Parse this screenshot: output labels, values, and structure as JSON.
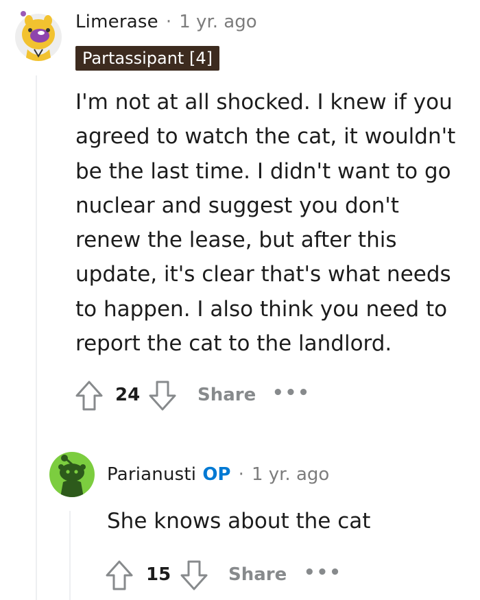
{
  "comments": [
    {
      "username": "Limerase",
      "separator": "·",
      "time": "1 yr. ago",
      "flair": "Partassipant [4]",
      "body": "I'm not at all shocked. I knew if you agreed to watch the cat, it wouldn't be the last time. I didn't want to go nuclear and suggest you don't renew the lease, but after this update, it's clear that's what needs to happen. I also think you need to report the cat to the landlord.",
      "votes": "24",
      "share_label": "Share",
      "more_label": "•••",
      "avatar_icon": "snoo-hamster-avatar-icon"
    },
    {
      "username": "Parianusti",
      "op_badge": "OP",
      "separator": "·",
      "time": "1 yr. ago",
      "body": "She knows about the cat",
      "votes": "15",
      "share_label": "Share",
      "more_label": "•••",
      "avatar_icon": "default-snoo-avatar-icon"
    }
  ],
  "colors": {
    "flair_bg": "#3d2b1f",
    "op": "#0079d3",
    "avatar2_bg": "#7ccd3f",
    "thread_line": "#edeff1",
    "muted": "#878a8c"
  }
}
